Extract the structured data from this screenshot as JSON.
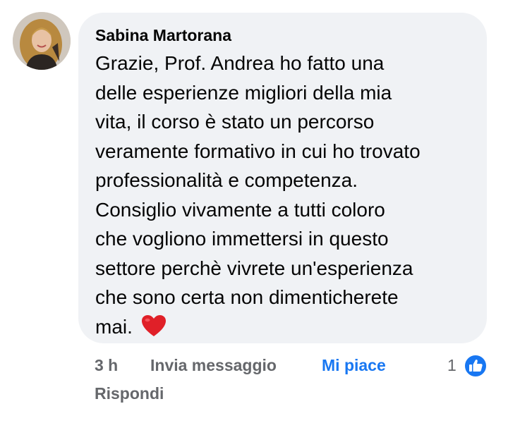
{
  "comment": {
    "author": "Sabina Martorana",
    "lines": [
      "Grazie, Prof. Andrea ho fatto una",
      "delle esperienze migliori della mia",
      "vita, il corso è stato un percorso",
      "veramente formativo in cui ho trovato",
      "professionalità e competenza.",
      "Consiglio vivamente a tutti coloro",
      "che vogliono immettersi in questo",
      "settore perchè vivrete un'esperienza",
      "che sono certa non dimenticherete",
      "mai."
    ],
    "emoji": "heart-emoji",
    "bubble_color": "#f0f2f5"
  },
  "actions": {
    "time": "3 h",
    "send_message": "Invia messaggio",
    "like": "Mi piace",
    "reply": "Rispondi",
    "reaction_count": "1",
    "reaction_icon": "thumbs-up-icon",
    "like_color": "#1877f2",
    "muted_color": "#65676b"
  }
}
